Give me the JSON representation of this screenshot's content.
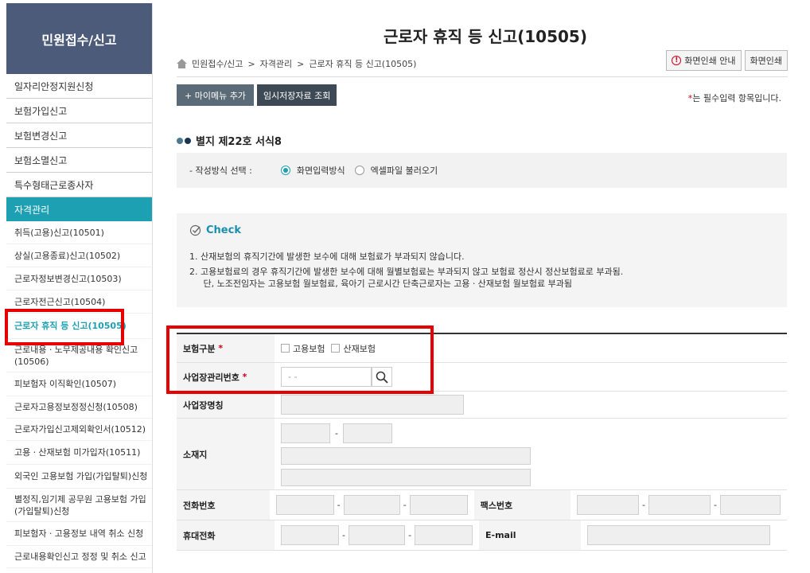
{
  "sidebar": {
    "header": "민원접수/신고",
    "items": [
      {
        "label": "일자리안정지원신청"
      },
      {
        "label": "보험가입신고"
      },
      {
        "label": "보험변경신고"
      },
      {
        "label": "보험소멸신고"
      },
      {
        "label": "특수형태근로종사자"
      }
    ],
    "group_label": "자격관리",
    "sub_items": [
      {
        "label": "취득(고용)신고(10501)"
      },
      {
        "label": "상실(고용종료)신고(10502)"
      },
      {
        "label": "근로자정보변경신고(10503)"
      },
      {
        "label": "근로자전근신고(10504)"
      },
      {
        "label": "근로자 휴직 등 신고(10505)"
      },
      {
        "label": "근로내용ㆍ노무제공내용 확인신고 (10506)"
      },
      {
        "label": "피보험자 이직확인(10507)"
      },
      {
        "label": "근로자고용정보정정신청(10508)"
      },
      {
        "label": "근로자가입신고제외확인서(10512)"
      },
      {
        "label": "고용ㆍ산재보험 미가입자(10511)"
      },
      {
        "label": "외국인 고용보험 가입(가입탈퇴)신청"
      },
      {
        "label": "별정직,임기제 공무원 고용보험 가입(가입탈퇴)신청"
      },
      {
        "label": "피보험자ㆍ고용정보 내역 취소 신청"
      },
      {
        "label": "근로내용확인신고 정정 및 취소 신고"
      }
    ]
  },
  "header": {
    "title": "근로자 휴직 등 신고(10505)",
    "breadcrumb": [
      "민원접수/신고",
      ">",
      "자격관리",
      ">",
      "근로자 휴직 등 신고(10505)"
    ],
    "print_guide_label": "화면인쇄 안내",
    "print_label": "화면인쇄"
  },
  "actions": {
    "add_menu_label": "+ 마이메뉴 추가",
    "temp_save_label": "임시저장자료 조회",
    "required_note_star": "*",
    "required_note": "는 필수입력 항목입니다."
  },
  "section": {
    "title": "별지 제22호 서식8",
    "method_label": "- 작성방식 선택 :",
    "method_options": [
      "화면입력방식",
      "엑셀파일 불러오기"
    ],
    "method_selected": "화면입력방식"
  },
  "check": {
    "title": "Check",
    "lines": [
      "1.  산재보험의 휴직기간에 발생한 보수에 대해 보험료가 부과되지 않습니다.",
      "2.  고용보험료의 경우 휴직기간에 발생한 보수에 대해 월별보험료는 부과되지 않고 보험료 정산시 정산보험료로 부과됨.",
      "     단, 노조전임자는 고용보험 월보험료, 육아기 근로시간 단축근로자는 고용ㆍ산재보험 월보험료 부과됨"
    ]
  },
  "form": {
    "insurance_type_label": "보험구분",
    "insurance_options": [
      "고용보험",
      "산재보험"
    ],
    "biz_no_label": "사업장관리번호",
    "biz_no_placeholder": "-  -",
    "biz_name_label": "사업장명칭",
    "address_label": "소재지",
    "address_sep": "-",
    "phone_label": "전화번호",
    "fax_label": "팩스번호",
    "mobile_label": "휴대전화",
    "email_label": "E-mail",
    "dash": "-"
  },
  "colors": {
    "sidebar_header_bg": "#4d5b7a",
    "accent": "#1ea0b3",
    "highlight": "#e60000"
  }
}
